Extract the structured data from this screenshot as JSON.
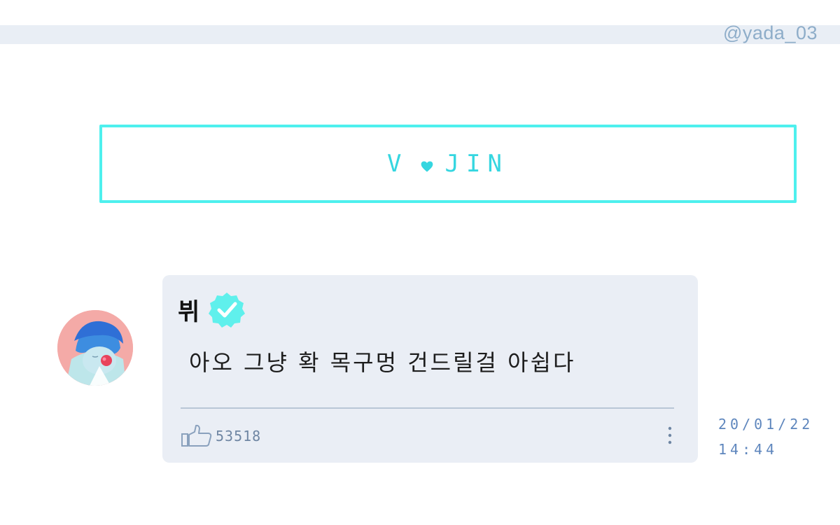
{
  "watermark": "@yada_03",
  "title": {
    "left": "V",
    "right": "JIN",
    "heart_icon": "heart-icon",
    "accent_color": "#4ef0ee"
  },
  "comment": {
    "author": "뷔",
    "verified_icon": "verified-badge-icon",
    "text": "아오 그냥 확 목구멍 건드릴걸 아쉽다",
    "likes": "53518",
    "like_icon": "thumbs-up-icon",
    "more_icon": "more-vertical-icon",
    "card_color": "#eaeef5"
  },
  "timestamp": {
    "date": "20/01/22",
    "time": "14:44"
  }
}
